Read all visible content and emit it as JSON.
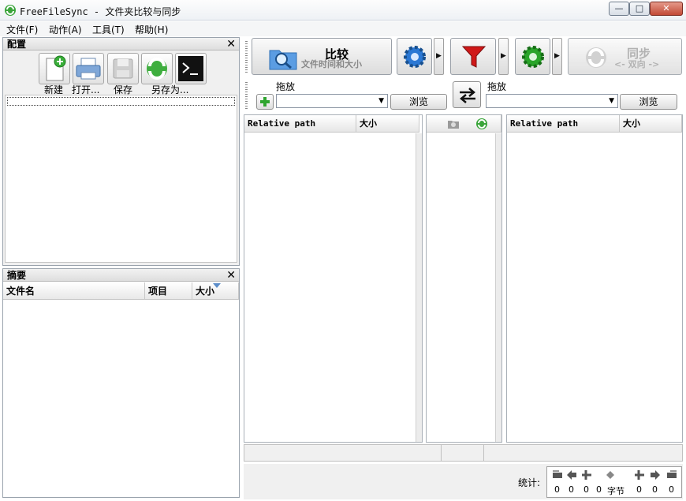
{
  "window": {
    "title": "FreeFileSync - 文件夹比较与同步",
    "min_glyph": "—",
    "max_glyph": "□",
    "close_glyph": "✕"
  },
  "menu": [
    "文件(F)",
    "动作(A)",
    "工具(T)",
    "帮助(H)"
  ],
  "config_panel": {
    "title": "配置",
    "close": "✕",
    "buttons": [
      {
        "label": "新建",
        "icon": "new-file-icon"
      },
      {
        "label": "打开...",
        "icon": "printer-icon"
      },
      {
        "label": "保存",
        "icon": "save-icon"
      },
      {
        "label": "另存为...",
        "icon": "save-as-icon"
      },
      {
        "label": "",
        "icon": "terminal-icon"
      }
    ]
  },
  "summary_panel": {
    "title": "摘要",
    "close": "✕",
    "columns": [
      "文件名",
      "项目",
      "大小"
    ]
  },
  "toolbar": {
    "compare_label": "比较",
    "compare_sub": "文件时间和大小",
    "sync_label": "同步",
    "sync_sub": "<- 双向 ->",
    "arrow": "▶"
  },
  "left_dir": {
    "label": "拖放",
    "value": "",
    "browse": "浏览"
  },
  "right_dir": {
    "label": "拖放",
    "value": "",
    "browse": "浏览"
  },
  "grid": {
    "left_columns": [
      "Relative path",
      "大小"
    ],
    "right_columns": [
      "Relative path",
      "大小"
    ]
  },
  "stats": {
    "label": "统计:",
    "values": [
      "0",
      "0",
      "0",
      "0",
      "字节",
      "0",
      "0",
      "0"
    ]
  },
  "colors": {
    "accent": "#1e7fd0",
    "filter_red": "#d01818",
    "gear_blue": "#2b78d4",
    "gear_green": "#2aa52a"
  }
}
